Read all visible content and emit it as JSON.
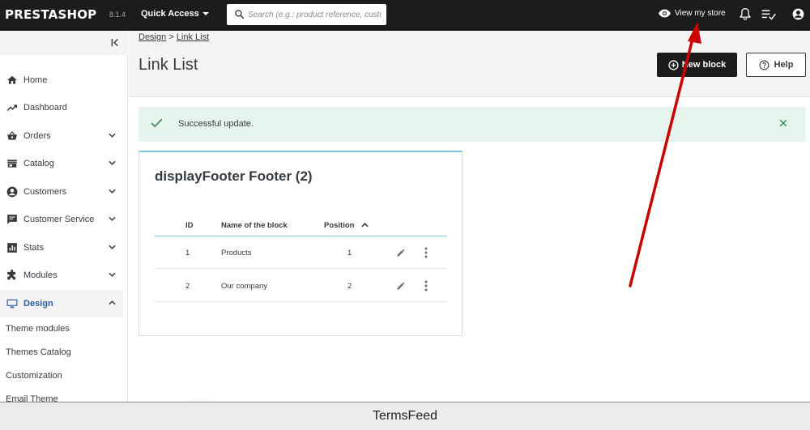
{
  "topbar": {
    "logo": "PRESTASHOP",
    "version": "8.1.4",
    "quick_access": "Quick Access",
    "search_placeholder": "Search (e.g.: product reference, custon",
    "view_store": "View my store",
    "icons": [
      "search-icon",
      "eye-icon",
      "bell-icon",
      "notifications-list-icon",
      "account-icon"
    ]
  },
  "sidebar": {
    "items": [
      {
        "label": "Home",
        "icon": "home-icon"
      },
      {
        "label": "Dashboard",
        "icon": "trending-up-icon"
      },
      {
        "label": "Orders",
        "icon": "basket-icon"
      },
      {
        "label": "Catalog",
        "icon": "store-icon"
      },
      {
        "label": "Customers",
        "icon": "account-circle-icon"
      },
      {
        "label": "Customer Service",
        "icon": "chat-icon"
      },
      {
        "label": "Stats",
        "icon": "bar-chart-icon"
      },
      {
        "label": "Modules",
        "icon": "puzzle-icon"
      },
      {
        "label": "Design",
        "icon": "desktop-icon",
        "active": true
      }
    ],
    "design_subitems": [
      "Theme modules",
      "Themes Catalog",
      "Customization",
      "Email Theme"
    ]
  },
  "header": {
    "breadcrumb_parent": "Design",
    "breadcrumb_sep": ">",
    "breadcrumb_current": "Link List",
    "title": "Link List",
    "new_block": "New block",
    "help": "Help"
  },
  "alert": {
    "message": "Successful update."
  },
  "card": {
    "title": "displayFooter Footer (2)",
    "columns": [
      "ID",
      "Name of the block",
      "Position"
    ],
    "rows": [
      {
        "id": "1",
        "name": "Products",
        "position": "1"
      },
      {
        "id": "2",
        "name": "Our company",
        "position": "2"
      }
    ]
  },
  "footer": {
    "text": "TermsFeed",
    "peek": "..........."
  },
  "colors": {
    "topbar": "#1c1c1c",
    "accent": "#25b9d7",
    "success_bg": "#e6f4ee",
    "success_icon": "#4a8a6c",
    "annotation": "#cc0000"
  }
}
